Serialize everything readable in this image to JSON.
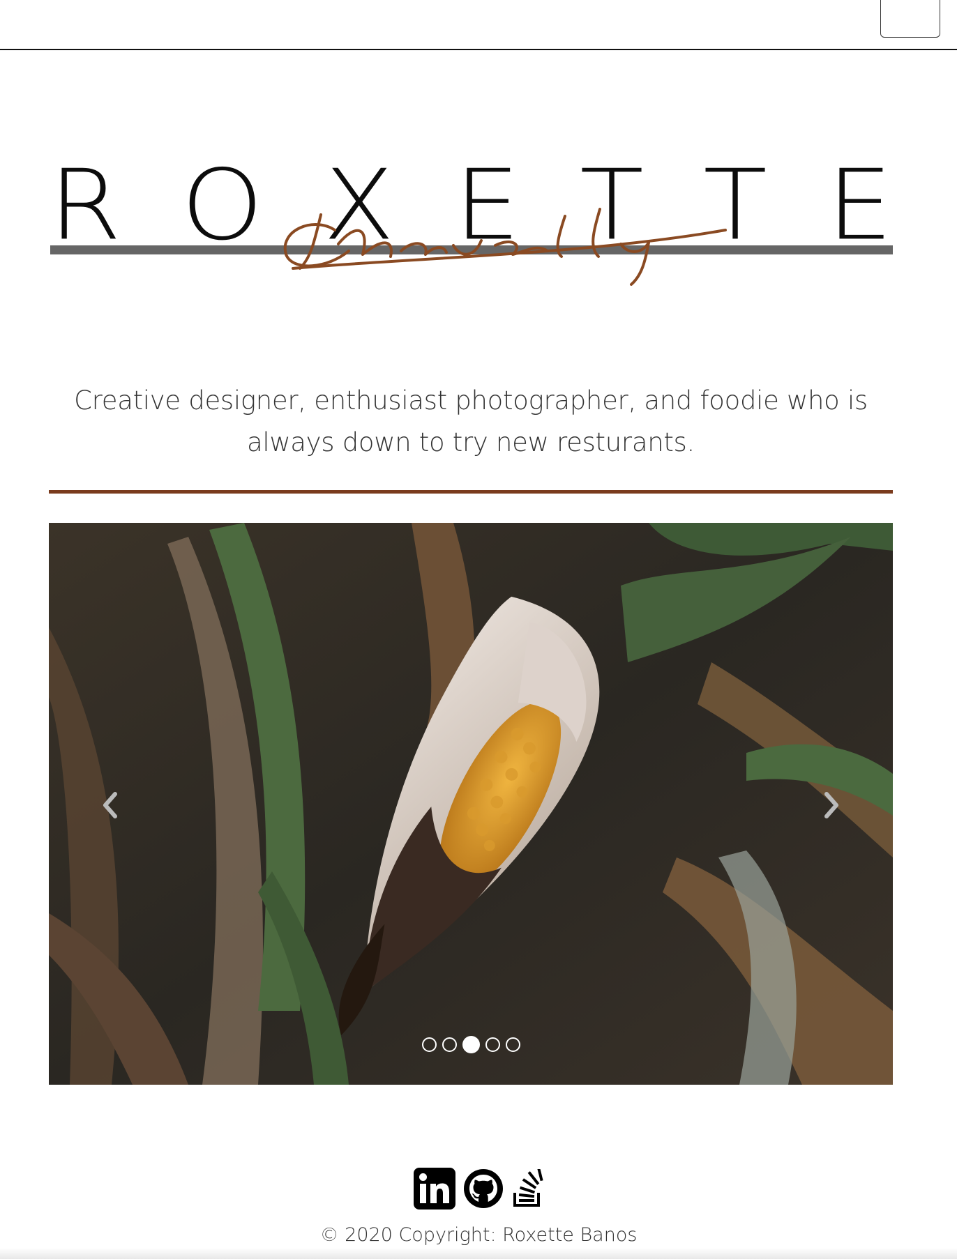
{
  "navbar": {
    "toggle_icon": "menu-toggle"
  },
  "logo": {
    "letters": [
      "R",
      "O",
      "X",
      "E",
      "T",
      "T",
      "E"
    ],
    "script": "Chavelly",
    "colors": {
      "main": "#0c0c0c",
      "bar": "#666666",
      "script": "#8a4a22"
    }
  },
  "tagline": "Creative designer, enthusiast photographer, and foodie who is always down to try new resturants.",
  "accent_color": "#7a3b1d",
  "carousel": {
    "slide_count": 5,
    "active_index": 2,
    "prev_icon": "chevron-left-icon",
    "next_icon": "chevron-right-icon"
  },
  "social": [
    {
      "name": "linkedin-icon",
      "label": "LinkedIn"
    },
    {
      "name": "github-icon",
      "label": "GitHub"
    },
    {
      "name": "stackoverflow-icon",
      "label": "Stack Overflow"
    }
  ],
  "footer": {
    "copyright": "© 2020 Copyright: Roxette Banos"
  }
}
